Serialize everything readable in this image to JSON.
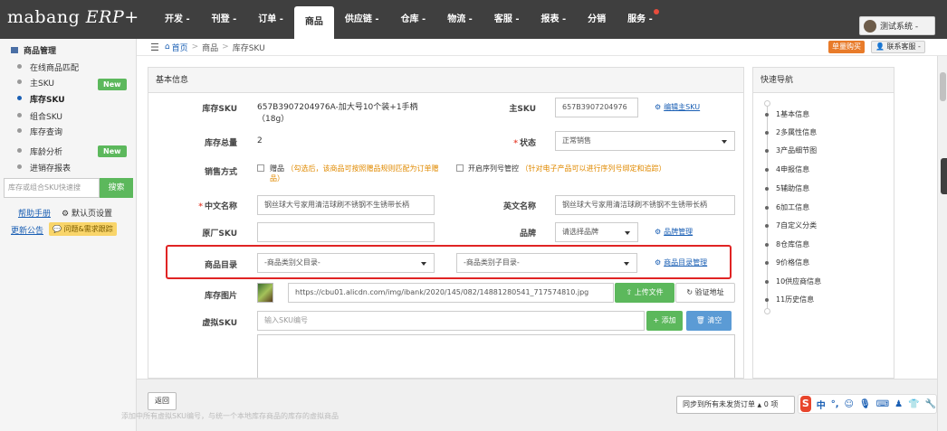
{
  "app": {
    "logo_main": "mabang",
    "logo_erp": "ERP+"
  },
  "nav": [
    {
      "label": "开发 -"
    },
    {
      "label": "刊登 -"
    },
    {
      "label": "订单 -"
    },
    {
      "label": "商品"
    },
    {
      "label": "供应链 -"
    },
    {
      "label": "仓库 -"
    },
    {
      "label": "物流 -"
    },
    {
      "label": "客服 -"
    },
    {
      "label": "报表 -"
    },
    {
      "label": "分销"
    },
    {
      "label": "服务 -"
    }
  ],
  "user": {
    "name": "测试系统 -"
  },
  "sidebar": {
    "title": "商品管理",
    "items": [
      {
        "label": "在线商品匹配"
      },
      {
        "label": "主SKU",
        "badge": "New"
      },
      {
        "label": "库存SKU"
      },
      {
        "label": "组合SKU"
      },
      {
        "label": "库存查询"
      },
      {
        "label": "库龄分析",
        "badge": "New"
      },
      {
        "label": "进销存报表"
      }
    ],
    "quick_placeholder": "库存或组合SKU快速搜",
    "quick_button": "搜索",
    "help": "帮助手册",
    "default_page": "默认页设置",
    "notice": "更新公告",
    "feedback": "问题&需求跟踪"
  },
  "breadcrumb": {
    "home": "首页",
    "section": "商品",
    "current": "库存SKU"
  },
  "top_actions": {
    "buy": "单量购买",
    "contact": "联系客服 -"
  },
  "panel": {
    "title": "基本信息",
    "stock_sku_label": "库存SKU",
    "stock_sku_value": "657B3907204976A-加大号10个装+1手柄（18g）",
    "main_sku_label": "主SKU",
    "main_sku_value": "657B3907204976",
    "edit_main_sku": "编辑主SKU",
    "stock_total_label": "库存总量",
    "stock_total_value": "2",
    "status_label": "状态",
    "status_value": "正常销售",
    "sale_mode_label": "销售方式",
    "gift_label": "赠品",
    "gift_note": "（勾选后，该商品可按照赠品规则匹配为订单赠品）",
    "serial_label": "开启序列号管控",
    "serial_note": "（针对电子产品可以进行序列号绑定和追踪）",
    "cn_name_label": "中文名称",
    "cn_name_value": "钢丝球大号家用清洁球刷不锈钢不生锈带长柄",
    "en_name_label": "英文名称",
    "en_name_value": "钢丝球大号家用清洁球刷不锈钢不生锈带长柄",
    "factory_sku_label": "原厂SKU",
    "brand_label": "品牌",
    "brand_placeholder": "请选择品牌",
    "brand_manage": "品牌管理",
    "category_label": "商品目录",
    "parent_cat": "-商品类别父目录-",
    "child_cat": "-商品类别子目录-",
    "cat_manage": "商品目录管理",
    "image_label": "库存图片",
    "image_url": "https://cbu01.alicdn.com/img/ibank/2020/145/082/14881280541_717574810.jpg",
    "upload_btn": "上传文件",
    "verify_btn": "验证地址",
    "virtual_sku_label": "虚拟SKU",
    "virtual_sku_placeholder": "输入SKU编号",
    "add_btn": "添加",
    "clear_btn": "清空"
  },
  "quicknav": {
    "title": "快速导航",
    "items": [
      "1基本信息",
      "2多属性信息",
      "3产品细节图",
      "4申报信息",
      "5辅助信息",
      "6加工信息",
      "7自定义分类",
      "8仓库信息",
      "9价格信息",
      "10供应商信息",
      "11历史信息"
    ]
  },
  "bottom": {
    "back": "返回",
    "sync": "同步到所有未发货订单",
    "sync_count": "0 项",
    "faded_note": "添加中所有虚拟SKU编号，与统一个本地库存商品的库存的虚拟商品"
  }
}
